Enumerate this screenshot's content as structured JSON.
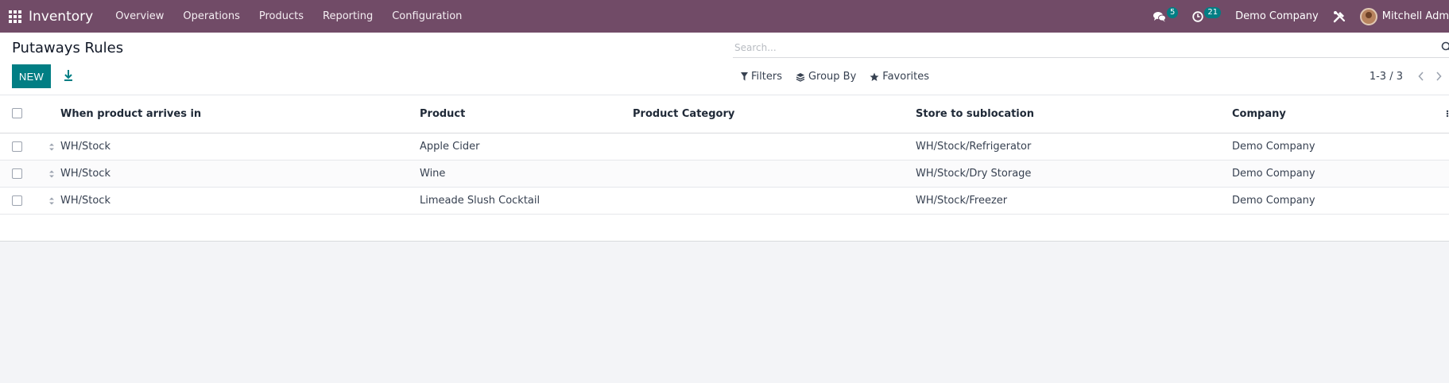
{
  "navbar": {
    "app_name": "Inventory",
    "menu": [
      "Overview",
      "Operations",
      "Products",
      "Reporting",
      "Configuration"
    ],
    "messages_count": "5",
    "activities_count": "21",
    "company": "Demo Company",
    "user": "Mitchell Adm",
    "bg_color": "#714b67"
  },
  "control_panel": {
    "title": "Putaways Rules",
    "new_label": "NEW",
    "search_placeholder": "Search...",
    "filters_label": "Filters",
    "groupby_label": "Group By",
    "favorites_label": "Favorites",
    "pager": "1-3 / 3",
    "accent_color": "#017e84"
  },
  "table": {
    "columns": [
      "When product arrives in",
      "Product",
      "Product Category",
      "Store to sublocation",
      "Company"
    ],
    "rows": [
      {
        "location_in": "WH/Stock",
        "product": "Apple Cider",
        "category": "",
        "location_out": "WH/Stock/Refrigerator",
        "company": "Demo Company"
      },
      {
        "location_in": "WH/Stock",
        "product": "Wine",
        "category": "",
        "location_out": "WH/Stock/Dry Storage",
        "company": "Demo Company"
      },
      {
        "location_in": "WH/Stock",
        "product": "Limeade Slush Cocktail",
        "category": "",
        "location_out": "WH/Stock/Freezer",
        "company": "Demo Company"
      }
    ]
  }
}
